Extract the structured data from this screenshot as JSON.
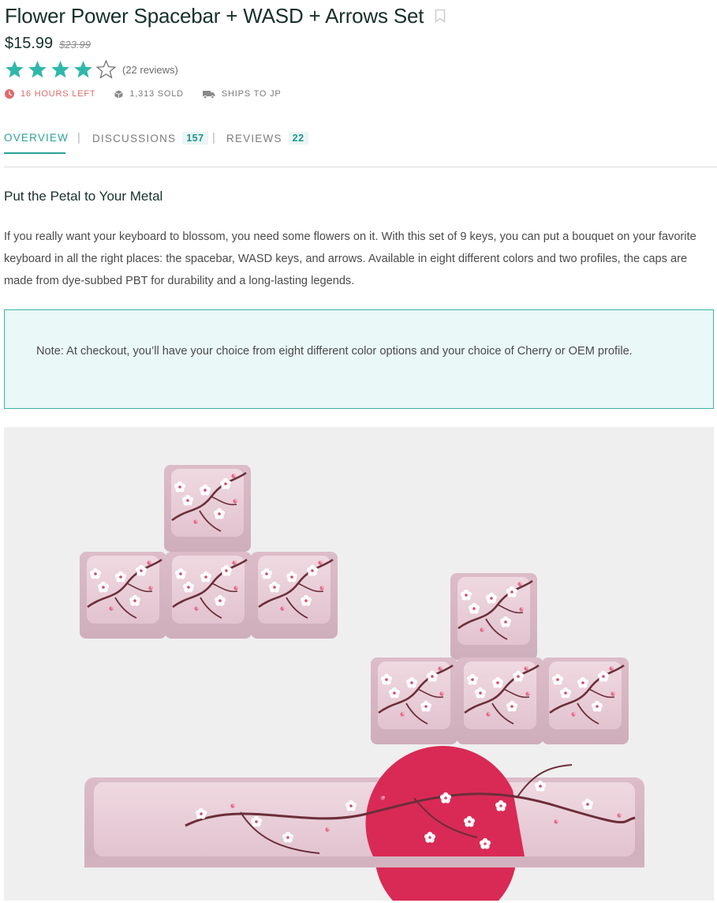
{
  "product": {
    "title": "Flower Power Spacebar + WASD + Arrows Set",
    "price": "$15.99",
    "original_price": "$23.99",
    "rating": 4,
    "rating_max": 5,
    "reviews_label": "(22 reviews)"
  },
  "meta": {
    "time_left": "16 HOURS LEFT",
    "sold": "1,313 SOLD",
    "shipping": "SHIPS TO JP"
  },
  "tabs": [
    {
      "label": "OVERVIEW",
      "badge": null,
      "active": true
    },
    {
      "label": "DISCUSSIONS",
      "badge": "157",
      "active": false
    },
    {
      "label": "REVIEWS",
      "badge": "22",
      "active": false
    }
  ],
  "tab_separator": "|",
  "overview": {
    "heading": "Put the Petal to Your Metal",
    "description": "If you really want your keyboard to blossom, you need some flowers on it. With this set of 9 keys, you can put a bouquet on your favorite keyboard in all the right places: the spacebar, WASD keys, and arrows. Available in eight different colors and two profiles, the caps are made from dye-subbed PBT for durability and a long-lasting legends.",
    "note": "Note: At checkout, you’ll have your choice from eight different color options and your choice of Cherry or OEM profile."
  },
  "colors": {
    "accent": "#2aa198",
    "star": "#2fb8aa",
    "urgent": "#e06a6a",
    "keycap": "#e8ccd6",
    "sun": "#d92a55",
    "branch": "#6b2e3a"
  },
  "icons": {
    "bookmark": "bookmark-icon",
    "clock": "clock-icon",
    "box": "box-icon",
    "truck": "truck-icon",
    "star_full": "star-full-icon",
    "star_empty": "star-outline-icon"
  }
}
